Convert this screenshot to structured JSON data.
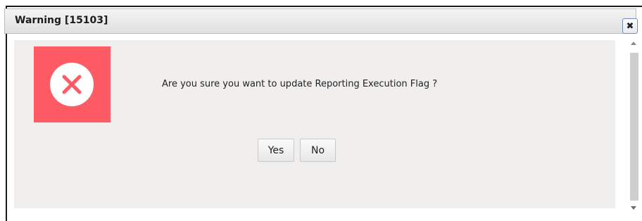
{
  "dialog": {
    "title": "Warning [15103]",
    "close_icon": "close-icon",
    "icon": "error-circle-x-icon",
    "message": "Are you sure you want to update Reporting Execution Flag ?",
    "buttons": {
      "yes": "Yes",
      "no": "No"
    },
    "colors": {
      "error_tile": "#ff5b64",
      "content_bg": "#f0efee"
    }
  }
}
